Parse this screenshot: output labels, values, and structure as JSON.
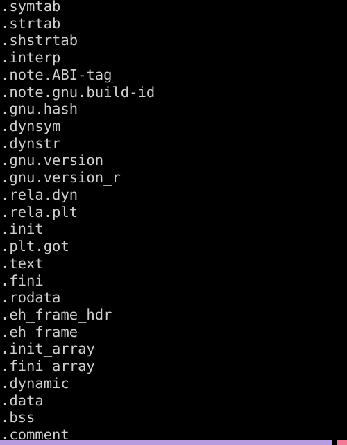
{
  "terminal": {
    "background_color": "#000000",
    "text_color": "#cfcfcf",
    "lines": [
      ".symtab",
      ".strtab",
      ".shstrtab",
      ".interp",
      ".note.ABI-tag",
      ".note.gnu.build-id",
      ".gnu.hash",
      ".dynsym",
      ".dynstr",
      ".gnu.version",
      ".gnu.version_r",
      ".rela.dyn",
      ".rela.plt",
      ".init",
      ".plt.got",
      ".text",
      ".fini",
      ".rodata",
      ".eh_frame_hdr",
      ".eh_frame",
      ".init_array",
      ".fini_array",
      ".dynamic",
      ".data",
      ".bss",
      ".comment"
    ]
  },
  "bottom_bar": {
    "track_color": "#b79ce0",
    "marker_color": "#ef7b96"
  }
}
